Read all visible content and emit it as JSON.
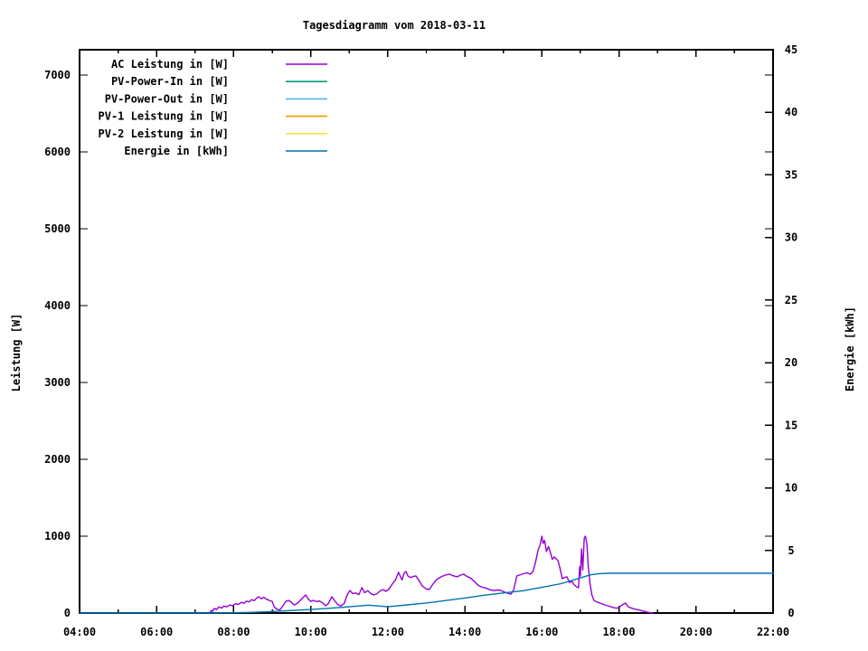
{
  "window": {
    "background": "#ffffff"
  },
  "chart_data": {
    "type": "line",
    "title": "Tagesdiagramm vom 2018-03-11",
    "legend_position": "top-left-inside",
    "grid": false,
    "x_axis": {
      "label": "",
      "range_hours": [
        4,
        22
      ],
      "major_tick_hours": [
        4,
        6,
        8,
        10,
        12,
        14,
        16,
        18,
        20,
        22
      ],
      "major_tick_labels": [
        "04:00",
        "06:00",
        "08:00",
        "10:00",
        "12:00",
        "14:00",
        "16:00",
        "18:00",
        "20:00",
        "22:00"
      ],
      "minor_tick_hours": [
        5,
        7,
        9,
        11,
        13,
        15,
        17,
        19,
        21
      ]
    },
    "y_axis": {
      "label": "Leistung [W]",
      "range": [
        0,
        7329
      ],
      "tick_values": [
        0,
        1000,
        2000,
        3000,
        4000,
        5000,
        6000,
        7000
      ],
      "tick_labels": [
        "0",
        "1000",
        "2000",
        "3000",
        "4000",
        "5000",
        "6000",
        "7000"
      ]
    },
    "y2_axis": {
      "label": "Energie [kWh]",
      "range": [
        0,
        45
      ],
      "tick_values": [
        0,
        5,
        10,
        15,
        20,
        25,
        30,
        35,
        40,
        45
      ],
      "tick_labels": [
        "0",
        "5",
        "10",
        "15",
        "20",
        "25",
        "30",
        "35",
        "40",
        "45"
      ]
    },
    "series": [
      {
        "name": "AC Leistung in [W]",
        "color": "#9400d3",
        "axis": "y1",
        "points": [
          [
            7.38,
            0
          ],
          [
            7.42,
            35
          ],
          [
            7.45,
            20
          ],
          [
            7.5,
            60
          ],
          [
            7.55,
            45
          ],
          [
            7.62,
            80
          ],
          [
            7.68,
            65
          ],
          [
            7.75,
            90
          ],
          [
            7.82,
            80
          ],
          [
            7.9,
            105
          ],
          [
            7.97,
            95
          ],
          [
            8.05,
            120
          ],
          [
            8.12,
            110
          ],
          [
            8.2,
            140
          ],
          [
            8.27,
            125
          ],
          [
            8.33,
            155
          ],
          [
            8.4,
            145
          ],
          [
            8.47,
            175
          ],
          [
            8.53,
            160
          ],
          [
            8.6,
            195
          ],
          [
            8.65,
            212
          ],
          [
            8.72,
            185
          ],
          [
            8.78,
            205
          ],
          [
            8.85,
            180
          ],
          [
            8.92,
            165
          ],
          [
            9.0,
            150
          ],
          [
            9.05,
            80
          ],
          [
            9.12,
            50
          ],
          [
            9.2,
            40
          ],
          [
            9.28,
            95
          ],
          [
            9.35,
            150
          ],
          [
            9.42,
            165
          ],
          [
            9.5,
            140
          ],
          [
            9.57,
            105
          ],
          [
            9.65,
            125
          ],
          [
            9.72,
            160
          ],
          [
            9.8,
            200
          ],
          [
            9.87,
            235
          ],
          [
            9.93,
            185
          ],
          [
            10.0,
            150
          ],
          [
            10.07,
            165
          ],
          [
            10.15,
            148
          ],
          [
            10.22,
            158
          ],
          [
            10.3,
            135
          ],
          [
            10.38,
            95
          ],
          [
            10.45,
            118
          ],
          [
            10.55,
            212
          ],
          [
            10.62,
            160
          ],
          [
            10.7,
            110
          ],
          [
            10.78,
            90
          ],
          [
            10.87,
            125
          ],
          [
            10.95,
            240
          ],
          [
            11.02,
            294
          ],
          [
            11.08,
            255
          ],
          [
            11.17,
            260
          ],
          [
            11.25,
            240
          ],
          [
            11.33,
            330
          ],
          [
            11.4,
            265
          ],
          [
            11.48,
            290
          ],
          [
            11.55,
            258
          ],
          [
            11.63,
            235
          ],
          [
            11.72,
            252
          ],
          [
            11.8,
            288
          ],
          [
            11.88,
            305
          ],
          [
            11.95,
            282
          ],
          [
            12.03,
            312
          ],
          [
            12.12,
            380
          ],
          [
            12.2,
            430
          ],
          [
            12.28,
            530
          ],
          [
            12.32,
            485
          ],
          [
            12.37,
            430
          ],
          [
            12.42,
            515
          ],
          [
            12.47,
            541
          ],
          [
            12.53,
            475
          ],
          [
            12.6,
            462
          ],
          [
            12.67,
            478
          ],
          [
            12.73,
            482
          ],
          [
            12.82,
            415
          ],
          [
            12.9,
            350
          ],
          [
            13.0,
            312
          ],
          [
            13.08,
            306
          ],
          [
            13.17,
            375
          ],
          [
            13.28,
            440
          ],
          [
            13.4,
            475
          ],
          [
            13.5,
            495
          ],
          [
            13.6,
            506
          ],
          [
            13.7,
            485
          ],
          [
            13.8,
            472
          ],
          [
            13.9,
            495
          ],
          [
            13.97,
            506
          ],
          [
            14.05,
            478
          ],
          [
            14.15,
            455
          ],
          [
            14.25,
            408
          ],
          [
            14.35,
            360
          ],
          [
            14.45,
            335
          ],
          [
            14.55,
            325
          ],
          [
            14.65,
            302
          ],
          [
            14.75,
            292
          ],
          [
            14.85,
            300
          ],
          [
            14.95,
            292
          ],
          [
            15.05,
            268
          ],
          [
            15.15,
            252
          ],
          [
            15.2,
            247
          ],
          [
            15.27,
            305
          ],
          [
            15.35,
            482
          ],
          [
            15.45,
            500
          ],
          [
            15.53,
            512
          ],
          [
            15.62,
            522
          ],
          [
            15.7,
            505
          ],
          [
            15.77,
            541
          ],
          [
            15.83,
            650
          ],
          [
            15.9,
            820
          ],
          [
            15.95,
            882
          ],
          [
            16.0,
            1000
          ],
          [
            16.03,
            905
          ],
          [
            16.07,
            945
          ],
          [
            16.12,
            800
          ],
          [
            16.17,
            865
          ],
          [
            16.22,
            790
          ],
          [
            16.27,
            700
          ],
          [
            16.32,
            730
          ],
          [
            16.37,
            706
          ],
          [
            16.42,
            682
          ],
          [
            16.47,
            580
          ],
          [
            16.53,
            447
          ],
          [
            16.6,
            465
          ],
          [
            16.65,
            470
          ],
          [
            16.72,
            395
          ],
          [
            16.78,
            415
          ],
          [
            16.83,
            372
          ],
          [
            16.9,
            340
          ],
          [
            16.95,
            329
          ],
          [
            16.98,
            600
          ],
          [
            17.0,
            480
          ],
          [
            17.03,
            835
          ],
          [
            17.06,
            560
          ],
          [
            17.1,
            976
          ],
          [
            17.13,
            1000
          ],
          [
            17.17,
            895
          ],
          [
            17.2,
            620
          ],
          [
            17.25,
            380
          ],
          [
            17.3,
            230
          ],
          [
            17.35,
            165
          ],
          [
            17.42,
            145
          ],
          [
            17.5,
            130
          ],
          [
            17.58,
            115
          ],
          [
            17.67,
            100
          ],
          [
            17.75,
            88
          ],
          [
            17.85,
            72
          ],
          [
            17.95,
            62
          ],
          [
            18.03,
            82
          ],
          [
            18.1,
            110
          ],
          [
            18.17,
            129
          ],
          [
            18.23,
            85
          ],
          [
            18.3,
            68
          ],
          [
            18.4,
            52
          ],
          [
            18.5,
            42
          ],
          [
            18.6,
            28
          ],
          [
            18.7,
            15
          ],
          [
            18.8,
            5
          ],
          [
            18.88,
            0
          ]
        ]
      },
      {
        "name": "PV-Power-In in [W]",
        "color": "#009e73",
        "axis": "y1",
        "points": []
      },
      {
        "name": "PV-Power-Out in [W]",
        "color": "#56b4e9",
        "axis": "y1",
        "points": []
      },
      {
        "name": "PV-1 Leistung in [W]",
        "color": "#e69f00",
        "axis": "y1",
        "points": []
      },
      {
        "name": "PV-2 Leistung in [W]",
        "color": "#f0e442",
        "axis": "y1",
        "points": []
      },
      {
        "name": "Energie in [kWh]",
        "color": "#0072b2",
        "axis": "y2",
        "points": [
          [
            4.0,
            0
          ],
          [
            7.0,
            0
          ],
          [
            7.4,
            0
          ],
          [
            8.0,
            0.02
          ],
          [
            8.5,
            0.06
          ],
          [
            9.0,
            0.12
          ],
          [
            9.5,
            0.2
          ],
          [
            10.0,
            0.28
          ],
          [
            10.5,
            0.38
          ],
          [
            11.0,
            0.5
          ],
          [
            11.5,
            0.63
          ],
          [
            12.0,
            0.5
          ],
          [
            12.5,
            0.65
          ],
          [
            13.0,
            0.8
          ],
          [
            13.5,
            1.0
          ],
          [
            14.0,
            1.2
          ],
          [
            14.5,
            1.42
          ],
          [
            15.0,
            1.6
          ],
          [
            15.5,
            1.78
          ],
          [
            16.0,
            2.05
          ],
          [
            16.5,
            2.35
          ],
          [
            17.0,
            2.8
          ],
          [
            17.25,
            3.05
          ],
          [
            17.5,
            3.15
          ],
          [
            17.75,
            3.18
          ],
          [
            18.5,
            3.18
          ],
          [
            20.0,
            3.18
          ],
          [
            22.0,
            3.18
          ]
        ]
      }
    ]
  }
}
